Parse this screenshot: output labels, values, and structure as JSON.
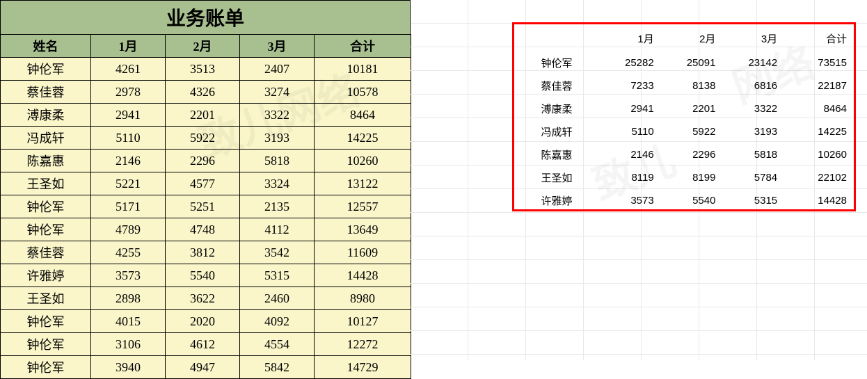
{
  "title": "业务账单",
  "left": {
    "headers": {
      "name": "姓名",
      "m1": "1月",
      "m2": "2月",
      "m3": "3月",
      "sum": "合计"
    },
    "rows": [
      {
        "name": "钟伦军",
        "m1": 4261,
        "m2": 3513,
        "m3": 2407,
        "sum": 10181
      },
      {
        "name": "蔡佳蓉",
        "m1": 2978,
        "m2": 4326,
        "m3": 3274,
        "sum": 10578
      },
      {
        "name": "溥康柔",
        "m1": 2941,
        "m2": 2201,
        "m3": 3322,
        "sum": 8464
      },
      {
        "name": "冯成轩",
        "m1": 5110,
        "m2": 5922,
        "m3": 3193,
        "sum": 14225
      },
      {
        "name": "陈嘉惠",
        "m1": 2146,
        "m2": 2296,
        "m3": 5818,
        "sum": 10260
      },
      {
        "name": "王圣如",
        "m1": 5221,
        "m2": 4577,
        "m3": 3324,
        "sum": 13122
      },
      {
        "name": "钟伦军",
        "m1": 5171,
        "m2": 5251,
        "m3": 2135,
        "sum": 12557
      },
      {
        "name": "钟伦军",
        "m1": 4789,
        "m2": 4748,
        "m3": 4112,
        "sum": 13649
      },
      {
        "name": "蔡佳蓉",
        "m1": 4255,
        "m2": 3812,
        "m3": 3542,
        "sum": 11609
      },
      {
        "name": "许雅婷",
        "m1": 3573,
        "m2": 5540,
        "m3": 5315,
        "sum": 14428
      },
      {
        "name": "王圣如",
        "m1": 2898,
        "m2": 3622,
        "m3": 2460,
        "sum": 8980
      },
      {
        "name": "钟伦军",
        "m1": 4015,
        "m2": 2020,
        "m3": 4092,
        "sum": 10127
      },
      {
        "name": "钟伦军",
        "m1": 3106,
        "m2": 4612,
        "m3": 4554,
        "sum": 12272
      },
      {
        "name": "钟伦军",
        "m1": 3940,
        "m2": 4947,
        "m3": 5842,
        "sum": 14729
      }
    ]
  },
  "right": {
    "headers": {
      "name": "",
      "m1": "1月",
      "m2": "2月",
      "m3": "3月",
      "sum": "合计"
    },
    "rows": [
      {
        "name": "钟伦军",
        "m1": 25282,
        "m2": 25091,
        "m3": 23142,
        "sum": 73515
      },
      {
        "name": "蔡佳蓉",
        "m1": 7233,
        "m2": 8138,
        "m3": 6816,
        "sum": 22187
      },
      {
        "name": "溥康柔",
        "m1": 2941,
        "m2": 2201,
        "m3": 3322,
        "sum": 8464
      },
      {
        "name": "冯成轩",
        "m1": 5110,
        "m2": 5922,
        "m3": 3193,
        "sum": 14225
      },
      {
        "name": "陈嘉惠",
        "m1": 2146,
        "m2": 2296,
        "m3": 5818,
        "sum": 10260
      },
      {
        "name": "王圣如",
        "m1": 8119,
        "m2": 8199,
        "m3": 5784,
        "sum": 22102
      },
      {
        "name": "许雅婷",
        "m1": 3573,
        "m2": 5540,
        "m3": 5315,
        "sum": 14428
      }
    ]
  }
}
